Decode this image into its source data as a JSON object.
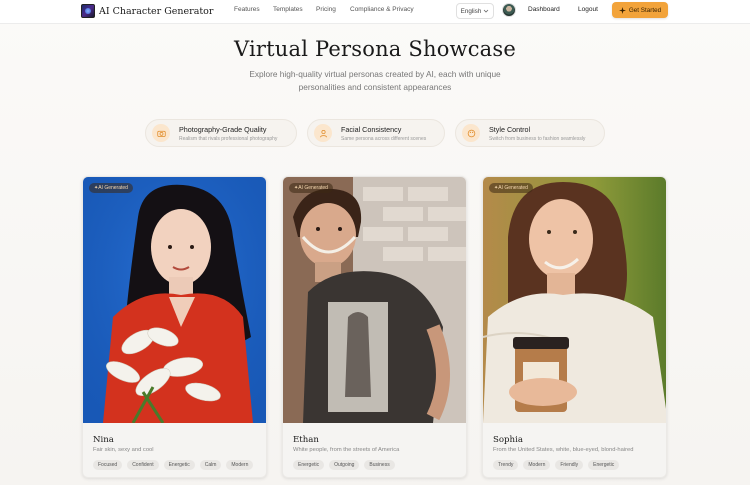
{
  "nav": {
    "brand": "AI Character Generator",
    "links": [
      "Features",
      "Templates",
      "Pricing",
      "Compliance & Privacy"
    ],
    "language": "English",
    "dashboard": "Dashboard",
    "logout": "Logout",
    "cta": "Get Started"
  },
  "hero": {
    "title": "Virtual Persona Showcase",
    "subtitle": "Explore high-quality virtual personas created by AI, each with unique personalities and consistent appearances"
  },
  "features": [
    {
      "title": "Photography-Grade Quality",
      "desc": "Realism that rivals professional photography",
      "icon": "camera-icon"
    },
    {
      "title": "Facial Consistency",
      "desc": "Same persona across different scenes",
      "icon": "users-icon"
    },
    {
      "title": "Style Control",
      "desc": "Switch from business to fashion seamlessly",
      "icon": "palette-icon"
    }
  ],
  "cards": [
    {
      "badge": "AI Generated",
      "name": "Nina",
      "desc": "Fair skin, sexy and cool",
      "tags": [
        "Focused",
        "Confident",
        "Energetic",
        "Calm",
        "Modern"
      ]
    },
    {
      "badge": "AI Generated",
      "name": "Ethan",
      "desc": "White people, from the streets of America",
      "tags": [
        "Energetic",
        "Outgoing",
        "Business"
      ]
    },
    {
      "badge": "AI Generated",
      "name": "Sophia",
      "desc": "From the United States, white, blue-eyed, blond-haired",
      "tags": [
        "Trendy",
        "Modern",
        "Friendly",
        "Energetic"
      ]
    }
  ],
  "colors": {
    "accent": "#f2a33a",
    "background": "#f7f5f2"
  }
}
